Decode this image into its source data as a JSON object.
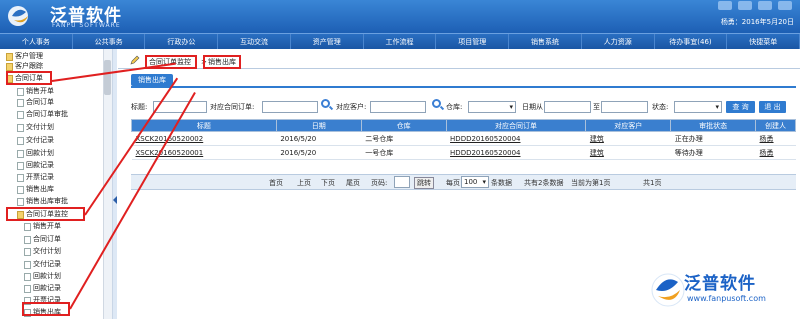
{
  "app": {
    "brand": "泛普软件",
    "brand_sub": "FANPU SOFTWARE",
    "user_info": "杨勇：2016年5月20日"
  },
  "nav": [
    "个人事务",
    "公共事务",
    "行政办公",
    "互动交流",
    "资产管理",
    "工作流程",
    "项目管理",
    "销售系统",
    "人力资源",
    "待办事宜(46)",
    "快捷菜单"
  ],
  "sidebar": {
    "items": [
      {
        "label": "客户管理",
        "indent": 1,
        "icon": "folder"
      },
      {
        "label": "客户跟踪",
        "indent": 1,
        "icon": "folder"
      },
      {
        "label": "合同订单",
        "indent": 1,
        "icon": "folder"
      },
      {
        "label": "销售开单",
        "indent": 2,
        "icon": "doc"
      },
      {
        "label": "合同订单",
        "indent": 2,
        "icon": "doc"
      },
      {
        "label": "合同订单审批",
        "indent": 2,
        "icon": "doc"
      },
      {
        "label": "交付计划",
        "indent": 2,
        "icon": "doc"
      },
      {
        "label": "交付记录",
        "indent": 2,
        "icon": "doc"
      },
      {
        "label": "回款计划",
        "indent": 2,
        "icon": "doc"
      },
      {
        "label": "回款记录",
        "indent": 2,
        "icon": "doc"
      },
      {
        "label": "开票记录",
        "indent": 2,
        "icon": "doc"
      },
      {
        "label": "销售出库",
        "indent": 2,
        "icon": "doc"
      },
      {
        "label": "销售出库审批",
        "indent": 2,
        "icon": "doc"
      },
      {
        "label": "合同订单监控",
        "indent": 1,
        "icon": "folder"
      },
      {
        "label": "销售开单",
        "indent": 2,
        "icon": "doc"
      },
      {
        "label": "合同订单",
        "indent": 2,
        "icon": "doc"
      },
      {
        "label": "交付计划",
        "indent": 2,
        "icon": "doc"
      },
      {
        "label": "交付记录",
        "indent": 2,
        "icon": "doc"
      },
      {
        "label": "回款计划",
        "indent": 2,
        "icon": "doc"
      },
      {
        "label": "回款记录",
        "indent": 2,
        "icon": "doc"
      },
      {
        "label": "开票记录",
        "indent": 2,
        "icon": "doc"
      },
      {
        "label": "销售出库",
        "indent": 2,
        "icon": "doc"
      }
    ]
  },
  "breadcrumb": {
    "parent": "合同订单监控",
    "current": "销售出库"
  },
  "subtab": "销售出库",
  "filters": {
    "title_label": "标题:",
    "contract_label": "对应合同订单:",
    "customer_label": "对应客户:",
    "warehouse_label": "仓库:",
    "date_label": "日期从",
    "to_label": "至",
    "status_label": "状态:",
    "search_btn": "查 询",
    "exit_btn": "退 出"
  },
  "table": {
    "columns": [
      "标题",
      "日期",
      "仓库",
      "对应合同订单",
      "对应客户",
      "审批状态",
      "创建人"
    ],
    "rows": [
      [
        "XSCK20160520002",
        "2016/5/20",
        "二号仓库",
        "HDDD20160520004",
        "建筑",
        "正在办理",
        "杨勇"
      ],
      [
        "XSCK20160520001",
        "2016/5/20",
        "一号仓库",
        "HDDD20160520004",
        "建筑",
        "等待办理",
        "杨勇"
      ]
    ]
  },
  "pager": {
    "first": "首页",
    "prev": "上页",
    "next": "下页",
    "last": "尾页",
    "page_no_label": "页码:",
    "jump_btn": "跳转",
    "per_page_prefix": "每页",
    "per_page_value": "100",
    "per_page_suffix": "条数据",
    "total": "共有2条数据",
    "current": "当前为第1页",
    "pages": "共1页"
  },
  "watermark": {
    "text": "泛普软件",
    "url": "www.fanpusoft.com"
  },
  "colors": {
    "header_blue": "#1d5fb4",
    "accent": "#2f7bd0",
    "highlight_red": "#e02020"
  }
}
